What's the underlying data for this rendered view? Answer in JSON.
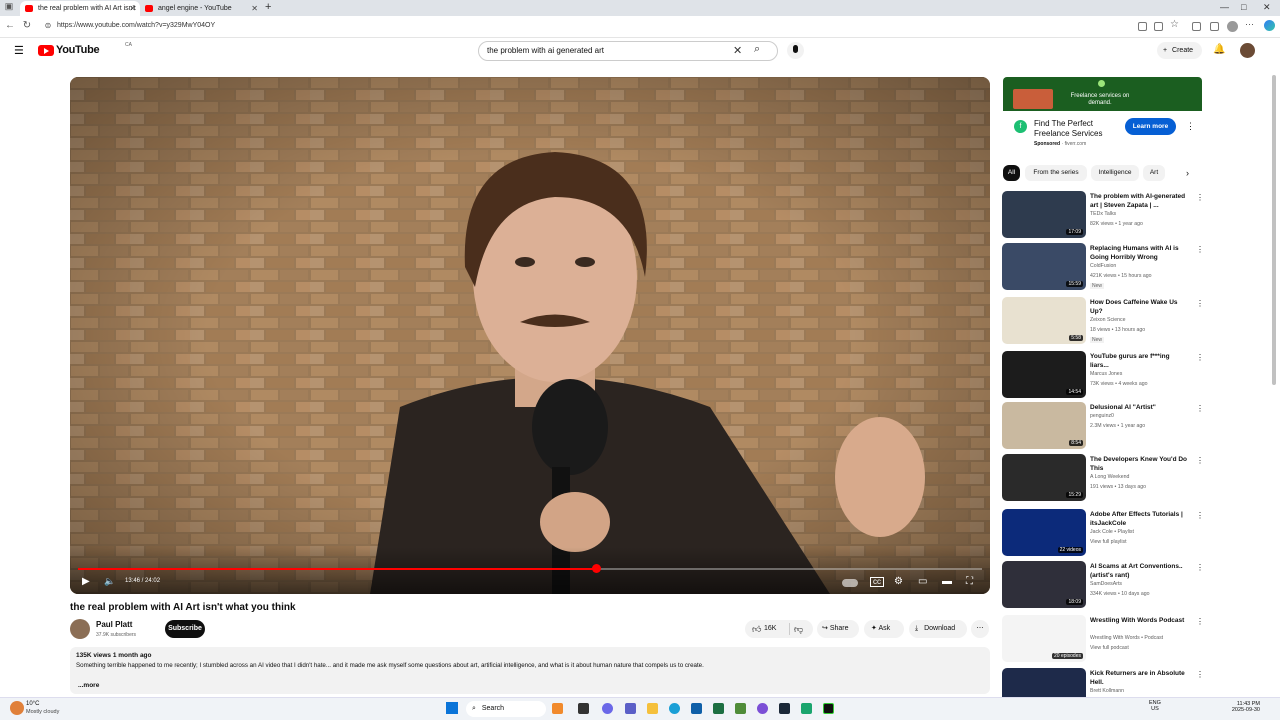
{
  "browser": {
    "tabs": [
      {
        "label": "the real problem with AI Art isn't",
        "active": true
      },
      {
        "label": "angel engine - YouTube",
        "active": false
      }
    ],
    "new_tab": "+",
    "url": "https://www.youtube.com/watch?v=y329MwY04OY"
  },
  "header": {
    "logo_text": "YouTube",
    "logo_region": "CA",
    "search_value": "the problem with ai generated art",
    "create_label": "Create"
  },
  "player": {
    "time": "13:46 / 24:02",
    "progress_fraction": 0.573
  },
  "video": {
    "title": "the real problem with AI Art isn't what you think",
    "channel": "Paul Platt",
    "subscribers": "37.9K subscribers",
    "subscribe_label": "Subscribe",
    "likes": "16K",
    "share_label": "Share",
    "ask_label": "Ask",
    "download_label": "Download",
    "views_date": "135K views  1 month ago",
    "description": "Something terrible happened to me recently; I stumbled across an AI video that I didn't hate... and it made me ask myself some questions about art, artificial intelligence, and what is it about human nature that compels us to create.",
    "more_label": "...more"
  },
  "ad": {
    "banner_text": "Freelance services on demand.",
    "title": "Find The Perfect Freelance Services",
    "sponsored": "Sponsored",
    "domain": "fiverr.com",
    "cta": "Learn more"
  },
  "chips": [
    "All",
    "From the series",
    "Intelligence",
    "Art"
  ],
  "recommendations": [
    {
      "title": "The problem with AI-generated art | Steven Zapata | ...",
      "channel": "TEDx Talks",
      "meta": "82K views • 1 year ago",
      "duration": "17:09",
      "badge": ""
    },
    {
      "title": "Replacing Humans with AI is Going Horribly Wrong",
      "channel": "ColdFusion",
      "meta": "421K views • 15 hours ago",
      "duration": "15:59",
      "badge": "New"
    },
    {
      "title": "How Does Caffeine Wake Us Up?",
      "channel": "Zeixon Science",
      "meta": "18 views • 13 hours ago",
      "duration": "5:58",
      "badge": "New"
    },
    {
      "title": "YouTube gurus are f***ing liars...",
      "channel": "Marcus Jones",
      "meta": "73K views • 4 weeks ago",
      "duration": "14:54",
      "badge": ""
    },
    {
      "title": "Delusional AI \"Artist\"",
      "channel": "penguinz0",
      "meta": "2.3M views • 1 year ago",
      "duration": "8:54",
      "badge": ""
    },
    {
      "title": "The Developers Knew You'd Do This",
      "channel": "A Long Weekend",
      "meta": "191 views • 13 days ago",
      "duration": "15:29",
      "badge": ""
    },
    {
      "title": "Adobe After Effects Tutorials | itsJackCole",
      "channel": "Jack Cole • Playlist",
      "meta": "View full playlist",
      "duration": "22 videos",
      "badge": ""
    },
    {
      "title": "AI Scams at Art Conventions.. (artist's rant)",
      "channel": "SamDoesArts",
      "meta": "334K views • 10 days ago",
      "duration": "18:09",
      "badge": ""
    },
    {
      "title": "Wrestling With Words Podcast",
      "channel": "Wrestling With Words • Podcast",
      "meta": "View full podcast",
      "duration": "20 episodes",
      "badge": ""
    },
    {
      "title": "Kick Returners are in Absolute Hell.",
      "channel": "Brett Kollmann",
      "meta": "",
      "duration": "",
      "badge": ""
    }
  ],
  "taskbar": {
    "weather_temp": "10°C",
    "weather_desc": "Mostly cloudy",
    "search_label": "Search",
    "lang": "ENG",
    "region": "US",
    "time": "11:43 PM",
    "date": "2025-09-30"
  },
  "colors": {
    "youtube_red": "#ff0000",
    "subscribe_bg": "#0f0f0f",
    "ad_cta": "#065fd4"
  }
}
